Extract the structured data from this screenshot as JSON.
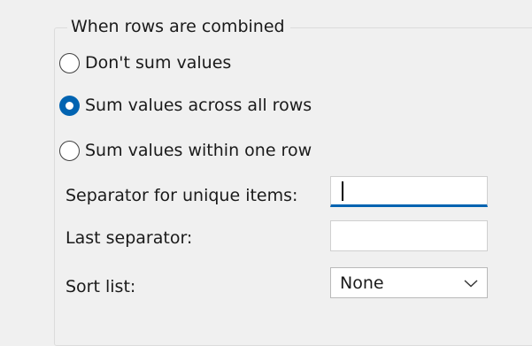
{
  "group": {
    "legend": "When rows are combined"
  },
  "radios": [
    {
      "label": "Don't sum values",
      "checked": false
    },
    {
      "label": "Sum values across all rows",
      "checked": true
    },
    {
      "label": "Sum values within one row",
      "checked": false
    }
  ],
  "fields": {
    "separator_label": "Separator for unique items:",
    "separator_value": "",
    "last_separator_label": "Last separator:",
    "last_separator_value": "",
    "sort_label": "Sort list:",
    "sort_value": "None"
  },
  "icons": {
    "dropdown": "chevron-down-icon"
  },
  "colors": {
    "accent": "#0063b1",
    "background": "#f0f0f0"
  }
}
